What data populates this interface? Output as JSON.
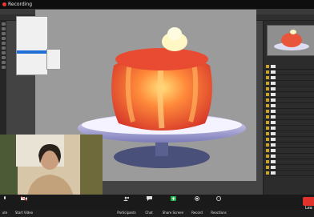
{
  "zoom": {
    "recording_label": "Recording",
    "toolbar": {
      "mute_label": "ute",
      "start_video_label": "Start Video",
      "participants_label": "Participants",
      "chat_label": "Chat",
      "share_screen_label": "Share Screen",
      "record_label": "Record",
      "reactions_label": "Reactions",
      "leave_label": "Lea",
      "participants_count": "2",
      "share_color": "#23b14d",
      "leave_color": "#e0322b"
    }
  },
  "icons": {
    "rec": "record-dot-icon",
    "mic": "microphone-icon",
    "video": "video-camera-icon",
    "participants": "participants-icon",
    "chat": "chat-icon",
    "share": "share-screen-icon",
    "record": "record-icon",
    "reactions": "reactions-icon"
  }
}
